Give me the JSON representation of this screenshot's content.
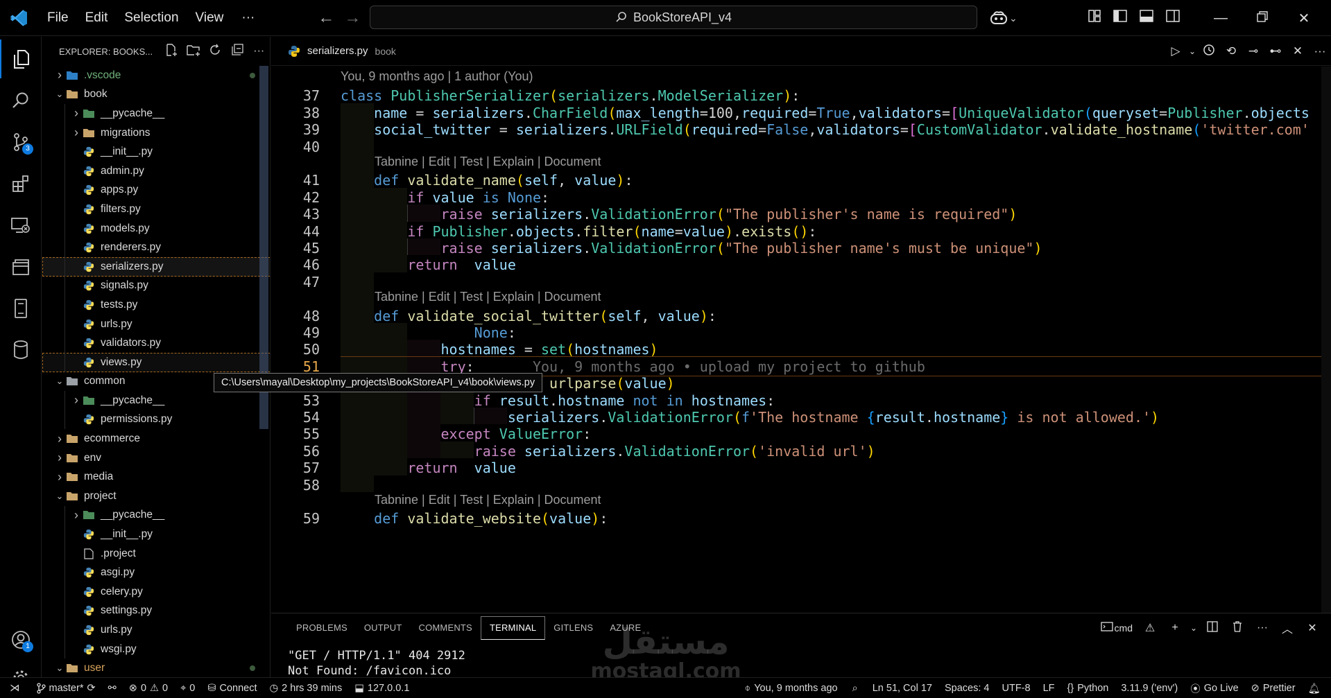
{
  "titlebar": {
    "menu": [
      "File",
      "Edit",
      "Selection",
      "View"
    ],
    "more": "···",
    "search_text": "BookStoreAPI_v4",
    "copilot_chevron": "⌄"
  },
  "activity_badges": {
    "source_control": "3",
    "accounts": "1"
  },
  "sidebar": {
    "title": "EXPLORER: BOOKS...",
    "tree": [
      {
        "label": ".vscode",
        "type": "folder-vscode",
        "depth": 0,
        "expanded": false,
        "dot": true
      },
      {
        "label": "book",
        "type": "folder",
        "depth": 0,
        "expanded": true
      },
      {
        "label": "__pycache__",
        "type": "folder-pycache",
        "depth": 1,
        "expanded": false
      },
      {
        "label": "migrations",
        "type": "folder",
        "depth": 1,
        "expanded": false
      },
      {
        "label": "__init__.py",
        "type": "py",
        "depth": 1
      },
      {
        "label": "admin.py",
        "type": "py",
        "depth": 1
      },
      {
        "label": "apps.py",
        "type": "py",
        "depth": 1
      },
      {
        "label": "filters.py",
        "type": "py",
        "depth": 1
      },
      {
        "label": "models.py",
        "type": "py",
        "depth": 1
      },
      {
        "label": "renderers.py",
        "type": "py",
        "depth": 1
      },
      {
        "label": "serializers.py",
        "type": "py",
        "depth": 1,
        "state": "selected"
      },
      {
        "label": "signals.py",
        "type": "py",
        "depth": 1
      },
      {
        "label": "tests.py",
        "type": "py",
        "depth": 1
      },
      {
        "label": "urls.py",
        "type": "py",
        "depth": 1
      },
      {
        "label": "validators.py",
        "type": "py",
        "depth": 1
      },
      {
        "label": "views.py",
        "type": "py",
        "depth": 1,
        "state": "hover"
      },
      {
        "label": "common",
        "type": "folder-common",
        "depth": 0,
        "expanded": true
      },
      {
        "label": "__pycache__",
        "type": "folder-pycache",
        "depth": 1,
        "expanded": false
      },
      {
        "label": "permissions.py",
        "type": "py",
        "depth": 1
      },
      {
        "label": "ecommerce",
        "type": "folder",
        "depth": 0,
        "expanded": false
      },
      {
        "label": "env",
        "type": "folder",
        "depth": 0,
        "expanded": false
      },
      {
        "label": "media",
        "type": "folder",
        "depth": 0,
        "expanded": false
      },
      {
        "label": "project",
        "type": "folder",
        "depth": 0,
        "expanded": true
      },
      {
        "label": "__pycache__",
        "type": "folder-pycache",
        "depth": 1,
        "expanded": false
      },
      {
        "label": "__init__.py",
        "type": "py",
        "depth": 1
      },
      {
        "label": ".project",
        "type": "file",
        "depth": 1
      },
      {
        "label": "asgi.py",
        "type": "py",
        "depth": 1
      },
      {
        "label": "celery.py",
        "type": "py",
        "depth": 1
      },
      {
        "label": "settings.py",
        "type": "py",
        "depth": 1
      },
      {
        "label": "urls.py",
        "type": "py",
        "depth": 1
      },
      {
        "label": "wsgi.py",
        "type": "py",
        "depth": 1
      },
      {
        "label": "user",
        "type": "folder",
        "depth": 0,
        "expanded": true,
        "dot": true,
        "orange": true
      }
    ],
    "tooltip": "C:\\Users\\mayal\\Desktop\\my_projects\\BookStoreAPI_v4\\book\\views.py"
  },
  "editor": {
    "tab_label": "serializers.py",
    "tab_desc": "book",
    "blame_top": "You, 9 months ago | 1 author (You)",
    "codelens": "Tabnine | Edit | Test | Explain | Document",
    "inline_blame": "You, 9 months ago • upload my project to github",
    "lines": [
      {
        "n": "37",
        "html": "<span class='k'>class</span> <span class='cls'>PublisherSerializer</span><span class='b1'>(</span><span class='cls'>serializers</span>.<span class='cls'>ModelSerializer</span><span class='b1'>)</span>:"
      },
      {
        "n": "38",
        "html": "    <span class='v'>name</span> = <span class='v'>serializers</span>.<span class='cls'>CharField</span><span class='b1'>(</span><span class='v'>max_length</span>=100,<span class='v'>required</span>=<span class='k'>True</span>,<span class='v'>validators</span>=<span class='b2'>[</span><span class='cls'>UniqueValidator</span><span class='b3'>(</span><span class='v'>queryset</span>=<span class='cls'>Publisher</span>.<span class='v'>objects</span>"
      },
      {
        "n": "39",
        "html": "    <span class='v'>social_twitter</span> = <span class='v'>serializers</span>.<span class='cls'>URLField</span><span class='b1'>(</span><span class='v'>required</span>=<span class='k'>False</span>,<span class='v'>validators</span>=<span class='b2'>[</span><span class='cls'>CustomValidator</span>.<span class='fn'>validate_hostname</span><span class='b3'>(</span><span class='s'>'twitter.com'</span>"
      },
      {
        "n": "40",
        "html": ""
      },
      {
        "n": "41",
        "html": "    <span class='k'>def</span> <span class='fn'>validate_name</span><span class='b1'>(</span><span class='v'>self</span>, <span class='v'>value</span><span class='b1'>)</span>:"
      },
      {
        "n": "42",
        "html": "        <span class='kw2'>if</span> <span class='v'>value</span> <span class='k'>is</span> <span class='k'>None</span>:"
      },
      {
        "n": "43",
        "html": "            <span class='kw2'>raise</span> <span class='v'>serializers</span>.<span class='cls'>ValidationError</span><span class='b1'>(</span><span class='s'>\"The publisher's name is required\"</span><span class='b1'>)</span>"
      },
      {
        "n": "44",
        "html": "        <span class='kw2'>if</span> <span class='cls'>Publisher</span>.<span class='v'>objects</span>.<span class='fn'>filter</span><span class='b1'>(</span><span class='v'>name</span>=<span class='v'>value</span><span class='b1'>)</span>.<span class='fn'>exists</span><span class='b1'>()</span>:"
      },
      {
        "n": "45",
        "html": "            <span class='kw2'>raise</span> <span class='v'>serializers</span>.<span class='cls'>ValidationError</span><span class='b1'>(</span><span class='s'>\"The publisher name's must be unique\"</span><span class='b1'>)</span>"
      },
      {
        "n": "46",
        "html": "        <span class='kw2'>return</span>  <span class='v'>value</span>"
      },
      {
        "n": "47",
        "html": ""
      },
      {
        "n": "48",
        "html": "    <span class='k'>def</span> <span class='fn'>validate_social_twitter</span><span class='b1'>(</span><span class='v'>self</span>, <span class='v'>value</span><span class='b1'>)</span>:"
      },
      {
        "n": "49",
        "html": "                <span class='k'>None</span>:"
      },
      {
        "n": "50",
        "html": "            <span class='v'>hostnames</span> = <span class='cls'>set</span><span class='b1'>(</span><span class='v'>hostnames</span><span class='b1'>)</span>"
      },
      {
        "n": "51",
        "html": "            <span class='kw2'>try</span>:       <span class='ghost'>You, 9 months ago • upload my project to github</span>"
      },
      {
        "n": "52",
        "html": "                <span class='v'>result</span> = <span class='fn'>urlparse</span><span class='b1'>(</span><span class='v'>value</span><span class='b1'>)</span>"
      },
      {
        "n": "53",
        "html": "                <span class='kw2'>if</span> <span class='v'>result</span>.<span class='v'>hostname</span> <span class='k'>not</span> <span class='k'>in</span> <span class='v'>hostnames</span>:"
      },
      {
        "n": "54",
        "html": "                    <span class='v'>serializers</span>.<span class='cls'>ValidationError</span><span class='b1'>(</span><span class='k'>f</span><span class='s'>'The hostname </span><span class='b3'>{</span><span class='v'>result</span>.<span class='v'>hostname</span><span class='b3'>}</span><span class='s'> is not allowed.'</span><span class='b1'>)</span>"
      },
      {
        "n": "55",
        "html": "            <span class='kw2'>except</span> <span class='cls'>ValueError</span>:"
      },
      {
        "n": "56",
        "html": "                <span class='kw2'>raise</span> <span class='v'>serializers</span>.<span class='cls'>ValidationError</span><span class='b1'>(</span><span class='s'>'invalid url'</span><span class='b1'>)</span>"
      },
      {
        "n": "57",
        "html": "        <span class='kw2'>return</span>  <span class='v'>value</span>"
      },
      {
        "n": "58",
        "html": ""
      },
      {
        "n": "59",
        "html": "    <span class='k'>def</span> <span class='fn'>validate_website</span><span class='b1'>(</span><span class='v'>value</span><span class='b1'>)</span>:"
      }
    ]
  },
  "panel": {
    "tabs": [
      "PROBLEMS",
      "OUTPUT",
      "COMMENTS",
      "TERMINAL",
      "GITLENS",
      "AZURE"
    ],
    "active_tab": "TERMINAL",
    "shell": "cmd",
    "terminal_lines": [
      "\"GET / HTTP/1.1\" 404 2912",
      "Not Found: /favicon.ico"
    ]
  },
  "watermark": {
    "arabic": "مستقل",
    "latin": "mostaql.com"
  },
  "statusbar": {
    "branch": "master*",
    "errors": "0",
    "warnings": "0",
    "info": "0",
    "ports": "0",
    "connect": "Connect",
    "time": "2 hrs 39 mins",
    "host": "127.0.0.1",
    "blame": "You, 9 months ago",
    "position": "Ln 51, Col 17",
    "spaces": "Spaces: 4",
    "encoding": "UTF-8",
    "eol": "LF",
    "language": "Python",
    "interpreter": "3.11.9 ('env')",
    "golive": "Go Live",
    "prettier": "Prettier"
  },
  "colors": {
    "accent": "#0e7be0",
    "current_line": "#e8a94a"
  }
}
